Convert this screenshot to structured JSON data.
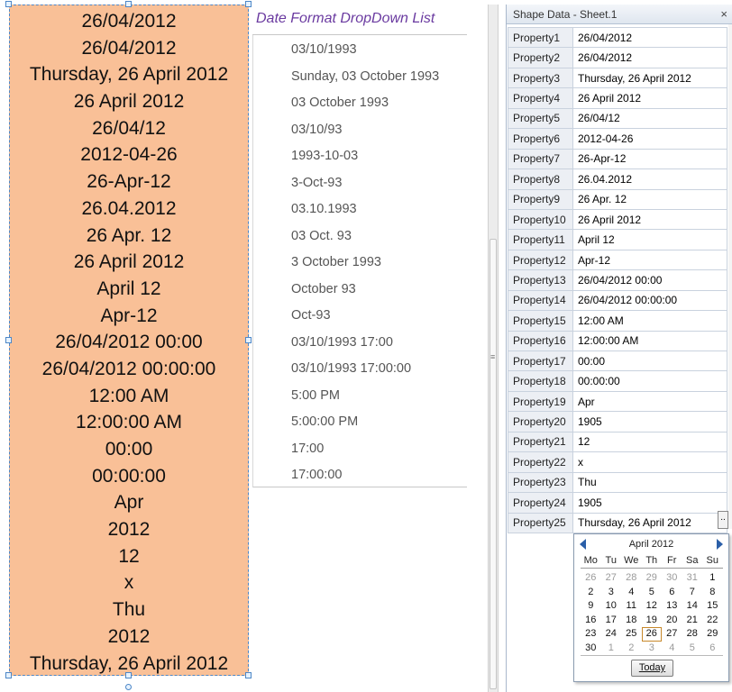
{
  "shape": {
    "lines": [
      "26/04/2012",
      "26/04/2012",
      "Thursday, 26 April 2012",
      "26 April 2012",
      "26/04/12",
      "2012-04-26",
      "26-Apr-12",
      "26.04.2012",
      "26 Apr. 12",
      "26 April 2012",
      "April 12",
      "Apr-12",
      "26/04/2012 00:00",
      "26/04/2012 00:00:00",
      "12:00 AM",
      "12:00:00 AM",
      "00:00",
      "00:00:00",
      "Apr",
      "2012",
      "12",
      "x",
      "Thu",
      "2012",
      "Thursday, 26 April 2012"
    ],
    "fill_color": "#f9c097"
  },
  "dropdown": {
    "title": "Date Format DropDown List",
    "title_color": "#6a3aa0",
    "items": [
      "03/10/1993",
      "Sunday, 03 October 1993",
      "03 October 1993",
      "03/10/93",
      "1993-10-03",
      "3-Oct-93",
      "03.10.1993",
      "03 Oct. 93",
      "3 October 1993",
      "October 93",
      "Oct-93",
      "03/10/1993 17:00",
      "03/10/1993 17:00:00",
      "5:00 PM",
      "5:00:00 PM",
      "17:00",
      "17:00:00"
    ]
  },
  "shape_data": {
    "title": "Shape Data - Sheet.1",
    "close_glyph": "×",
    "ellipsis": "..",
    "rows": [
      {
        "key": "Property1",
        "value": "26/04/2012"
      },
      {
        "key": "Property2",
        "value": "26/04/2012"
      },
      {
        "key": "Property3",
        "value": "Thursday, 26 April 2012"
      },
      {
        "key": "Property4",
        "value": "26 April 2012"
      },
      {
        "key": "Property5",
        "value": "26/04/12"
      },
      {
        "key": "Property6",
        "value": "2012-04-26"
      },
      {
        "key": "Property7",
        "value": "26-Apr-12"
      },
      {
        "key": "Property8",
        "value": "26.04.2012"
      },
      {
        "key": "Property9",
        "value": "26 Apr. 12"
      },
      {
        "key": "Property10",
        "value": "26 April 2012"
      },
      {
        "key": "Property11",
        "value": "April 12"
      },
      {
        "key": "Property12",
        "value": "Apr-12"
      },
      {
        "key": "Property13",
        "value": "26/04/2012 00:00"
      },
      {
        "key": "Property14",
        "value": "26/04/2012 00:00:00"
      },
      {
        "key": "Property15",
        "value": "12:00 AM"
      },
      {
        "key": "Property16",
        "value": "12:00:00 AM"
      },
      {
        "key": "Property17",
        "value": "00:00"
      },
      {
        "key": "Property18",
        "value": "00:00:00"
      },
      {
        "key": "Property19",
        "value": "Apr"
      },
      {
        "key": "Property20",
        "value": "1905"
      },
      {
        "key": "Property21",
        "value": "12"
      },
      {
        "key": "Property22",
        "value": "x"
      },
      {
        "key": "Property23",
        "value": "Thu"
      },
      {
        "key": "Property24",
        "value": "1905"
      },
      {
        "key": "Property25",
        "value": "Thursday, 26 April 2012"
      }
    ]
  },
  "calendar": {
    "month_label": "April 2012",
    "weekdays": [
      "Mo",
      "Tu",
      "We",
      "Th",
      "Fr",
      "Sa",
      "Su"
    ],
    "days": [
      {
        "d": "26",
        "other": true
      },
      {
        "d": "27",
        "other": true
      },
      {
        "d": "28",
        "other": true
      },
      {
        "d": "29",
        "other": true
      },
      {
        "d": "30",
        "other": true
      },
      {
        "d": "31",
        "other": true
      },
      {
        "d": "1",
        "other": false
      },
      {
        "d": "2",
        "other": false
      },
      {
        "d": "3",
        "other": false
      },
      {
        "d": "4",
        "other": false
      },
      {
        "d": "5",
        "other": false
      },
      {
        "d": "6",
        "other": false
      },
      {
        "d": "7",
        "other": false
      },
      {
        "d": "8",
        "other": false
      },
      {
        "d": "9",
        "other": false
      },
      {
        "d": "10",
        "other": false
      },
      {
        "d": "11",
        "other": false
      },
      {
        "d": "12",
        "other": false
      },
      {
        "d": "13",
        "other": false
      },
      {
        "d": "14",
        "other": false
      },
      {
        "d": "15",
        "other": false
      },
      {
        "d": "16",
        "other": false
      },
      {
        "d": "17",
        "other": false
      },
      {
        "d": "18",
        "other": false
      },
      {
        "d": "19",
        "other": false
      },
      {
        "d": "20",
        "other": false
      },
      {
        "d": "21",
        "other": false
      },
      {
        "d": "22",
        "other": false
      },
      {
        "d": "23",
        "other": false
      },
      {
        "d": "24",
        "other": false
      },
      {
        "d": "25",
        "other": false
      },
      {
        "d": "26",
        "other": false,
        "today": true
      },
      {
        "d": "27",
        "other": false
      },
      {
        "d": "28",
        "other": false
      },
      {
        "d": "29",
        "other": false
      },
      {
        "d": "30",
        "other": false
      },
      {
        "d": "1",
        "other": true
      },
      {
        "d": "2",
        "other": true
      },
      {
        "d": "3",
        "other": true
      },
      {
        "d": "4",
        "other": true
      },
      {
        "d": "5",
        "other": true
      },
      {
        "d": "6",
        "other": true
      }
    ],
    "today_button": "Today",
    "selected_day": "26"
  },
  "icons": {
    "calendar_prev": "chevron-left-icon",
    "calendar_next": "chevron-right-icon",
    "splitter_grip": "grip-icon"
  }
}
